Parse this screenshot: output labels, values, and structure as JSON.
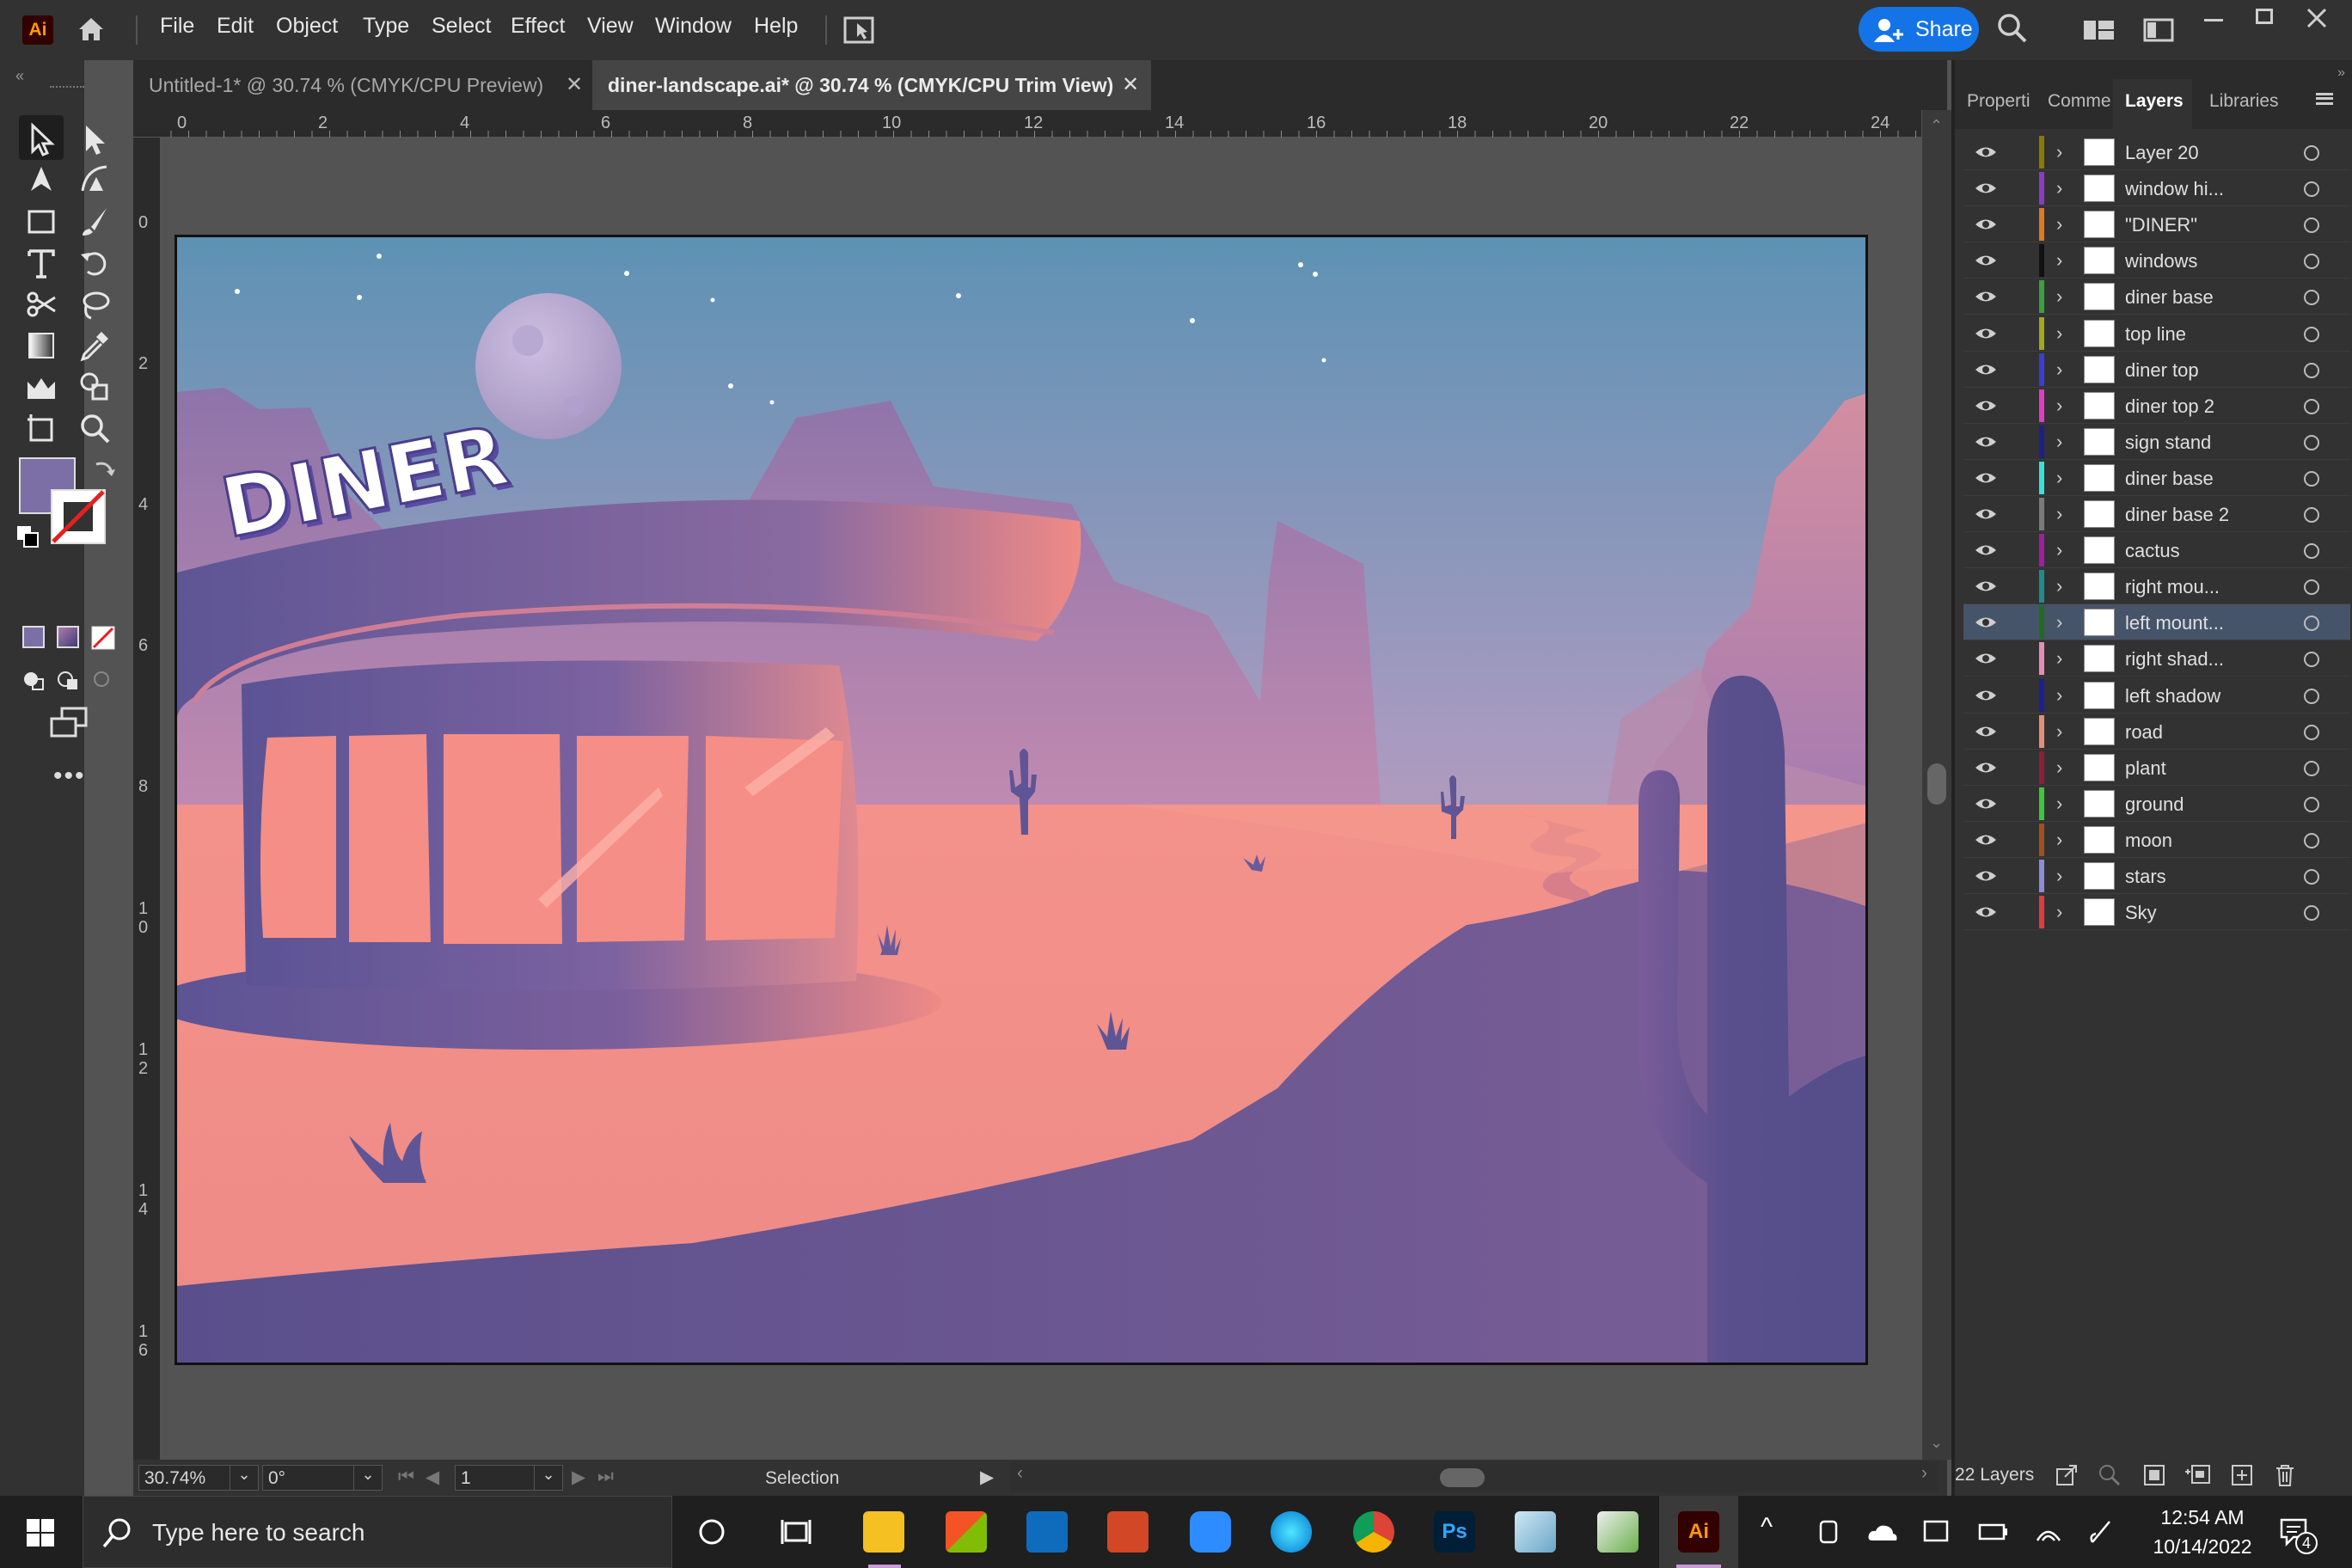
{
  "app": {
    "logo": "Ai"
  },
  "menu": {
    "items": [
      "File",
      "Edit",
      "Object",
      "Type",
      "Select",
      "Effect",
      "View",
      "Window",
      "Help"
    ]
  },
  "share": {
    "label": "Share"
  },
  "tabs": [
    {
      "label": "Untitled-1* @ 30.74 % (CMYK/CPU Preview)",
      "active": false
    },
    {
      "label": "diner-landscape.ai* @ 30.74 % (CMYK/CPU Trim View)",
      "active": true
    }
  ],
  "ruler": {
    "top": [
      "0",
      "2",
      "4",
      "6",
      "8",
      "10",
      "12",
      "14",
      "16",
      "18",
      "20",
      "22",
      "24"
    ],
    "left": [
      "0",
      "2",
      "4",
      "6",
      "8",
      "10",
      "12",
      "14",
      "16"
    ]
  },
  "artwork": {
    "sign_text": "DINER"
  },
  "status": {
    "zoom": "30.74%",
    "rotation": "0°",
    "artboard": "1",
    "tool": "Selection"
  },
  "panel": {
    "tabs": [
      "Properti",
      "Comme",
      "Layers",
      "Libraries"
    ],
    "active_tab": "Layers",
    "layer_count": "22 Layers",
    "layers": [
      {
        "name": "Layer 20",
        "color": "#8a7a00"
      },
      {
        "name": "window hi...",
        "color": "#8a3cc4"
      },
      {
        "name": "\"DINER\"",
        "color": "#e0781e"
      },
      {
        "name": "windows",
        "color": "#111111"
      },
      {
        "name": "diner base",
        "color": "#3ca03c"
      },
      {
        "name": "top line",
        "color": "#a0a81e"
      },
      {
        "name": "diner top",
        "color": "#3c3cd8"
      },
      {
        "name": "diner top 2",
        "color": "#e03cc8"
      },
      {
        "name": "sign stand",
        "color": "#1e1e8c"
      },
      {
        "name": "diner base",
        "color": "#3ce0d8"
      },
      {
        "name": "diner base 2",
        "color": "#7a7a7a"
      },
      {
        "name": "cactus",
        "color": "#a01ea0"
      },
      {
        "name": "right mou...",
        "color": "#1e8c8c"
      },
      {
        "name": "left mount...",
        "color": "#1e6e1e"
      },
      {
        "name": "right shad...",
        "color": "#e88cb4"
      },
      {
        "name": "left shadow",
        "color": "#1e1e9c"
      },
      {
        "name": "road",
        "color": "#e88c7a"
      },
      {
        "name": "plant",
        "color": "#8c1e3c"
      },
      {
        "name": "ground",
        "color": "#3cc83c"
      },
      {
        "name": "moon",
        "color": "#a0501e"
      },
      {
        "name": "stars",
        "color": "#8c8cd8"
      },
      {
        "name": "Sky",
        "color": "#e03c3c"
      }
    ],
    "selected_layer": "left mount..."
  },
  "taskbar": {
    "search_placeholder": "Type here to search",
    "time": "12:54 AM",
    "date": "10/14/2022",
    "notification_count": "4"
  },
  "colors": {
    "accent": "#1473e6",
    "fill_swatch": "#7b6fa6"
  }
}
